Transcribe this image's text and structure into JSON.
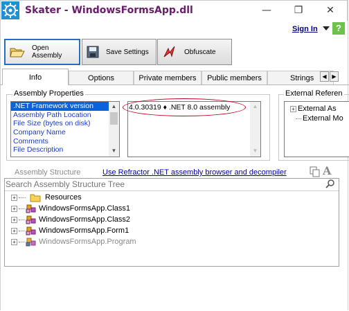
{
  "window": {
    "title": "Skater - WindowsFormsApp.dll",
    "minimize_glyph": "—",
    "restore_glyph": "❐",
    "close_glyph": "✕"
  },
  "header": {
    "signin_label": "Sign In",
    "help_label": "?"
  },
  "toolbar": {
    "open_label": "Open Assembly",
    "save_label": "Save Settings",
    "obfuscate_label": "Obfuscate"
  },
  "tabs": [
    {
      "label": "Info"
    },
    {
      "label": "Options"
    },
    {
      "label": "Private members"
    },
    {
      "label": "Public members"
    },
    {
      "label": "Strings"
    }
  ],
  "assembly_properties": {
    "title": "Assembly Properties",
    "items": [
      ".NET Framework version",
      "Assembly Path Location",
      "File Size (bytes on disk)",
      "Company Name",
      "Comments",
      "File Description"
    ],
    "selected_index": 0,
    "value_text": "4.0.30319 ♦ .NET 8.0 assembly"
  },
  "external_references": {
    "title": "External Referen",
    "items": [
      "External As",
      "External Mo"
    ]
  },
  "assembly_structure": {
    "title": "Assembly Structure",
    "link": "Use Refractor .NET assembly browser and decompiler",
    "search_placeholder": "Search Assembly Structure Tree",
    "tree": [
      {
        "label": "Resources",
        "icon": "folder-icon",
        "dim": false
      },
      {
        "label": "WindowsFormsApp.Class1",
        "icon": "class-icon",
        "dim": false
      },
      {
        "label": "WindowsFormsApp.Class2",
        "icon": "class-icon",
        "dim": false
      },
      {
        "label": "WindowsFormsApp.Form1",
        "icon": "class-icon",
        "dim": false
      },
      {
        "label": "WindowsFormsApp.Program",
        "icon": "class-icon",
        "dim": true
      }
    ]
  },
  "colors": {
    "title": "#6a1b6a",
    "accent": "#0a64d8",
    "help": "#6cc24a",
    "annotation": "#c0001a"
  }
}
